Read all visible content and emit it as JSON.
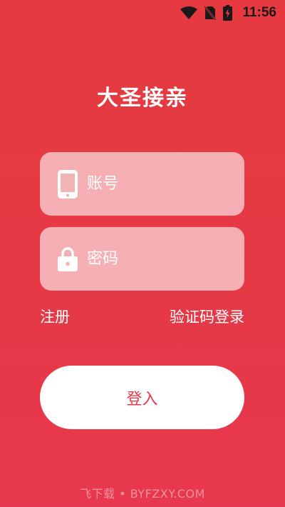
{
  "status_bar": {
    "time": "11:56",
    "icons": [
      "wifi-icon",
      "no-sim-icon",
      "battery-charging-icon"
    ]
  },
  "app": {
    "title": "大圣接亲"
  },
  "form": {
    "phone_placeholder": "账号",
    "phone_icon": "mobile-phone-icon",
    "password_placeholder": "密码",
    "password_icon": "lock-icon"
  },
  "links": {
    "register": "注册",
    "code_login": "验证码登录"
  },
  "login_button": {
    "label": "登入"
  },
  "watermark": {
    "text": "飞下载 • BYFZXY.COM"
  },
  "colors": {
    "background": "#e63946",
    "button_text": "#e6394a",
    "field_bg": "#ffffff99"
  }
}
